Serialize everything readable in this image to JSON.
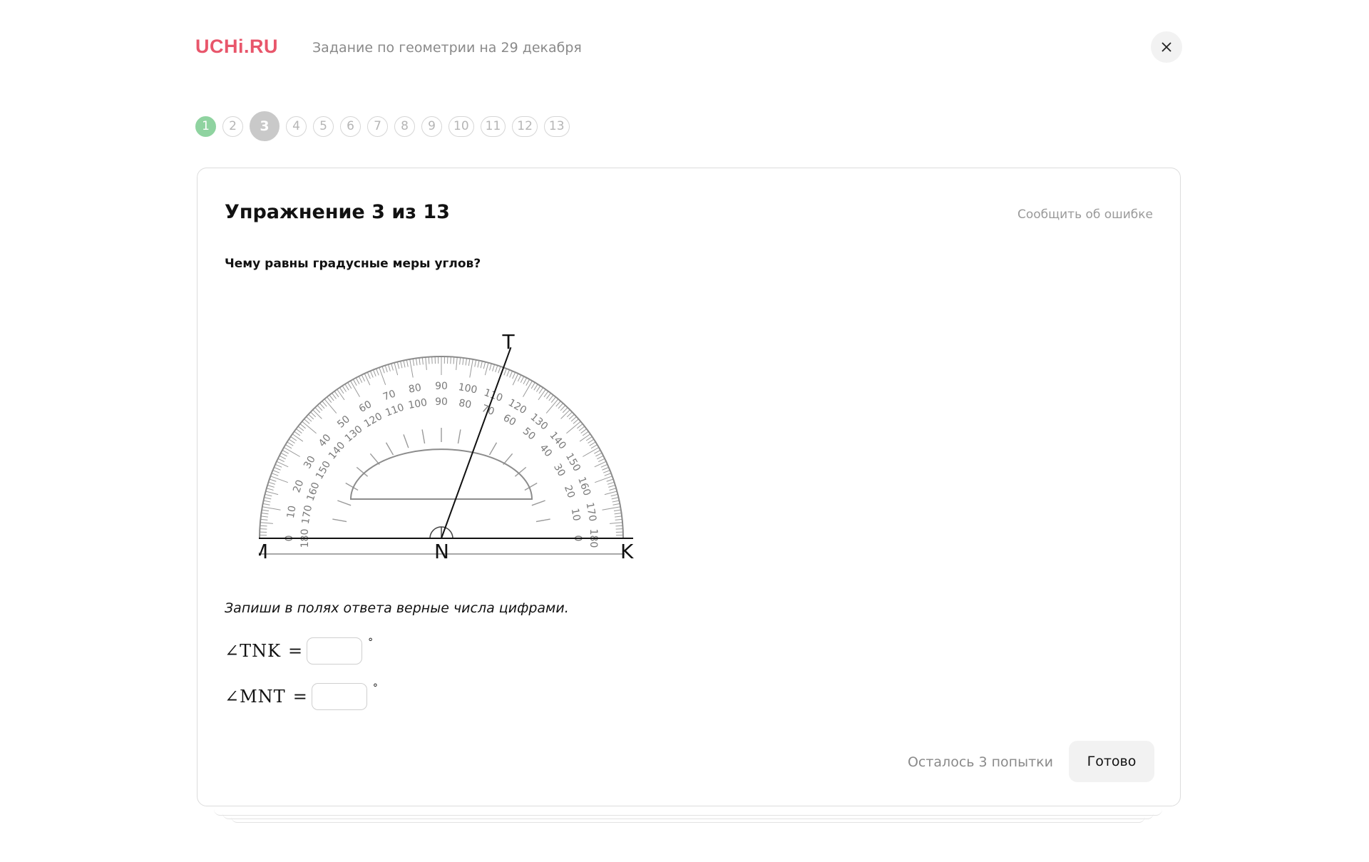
{
  "header": {
    "logo": "UCHi.RU",
    "title": "Задание по геометрии на 29 декабря"
  },
  "steps": [
    "1",
    "2",
    "3",
    "4",
    "5",
    "6",
    "7",
    "8",
    "9",
    "10",
    "11",
    "12",
    "13"
  ],
  "steps_state": {
    "done": [
      1
    ],
    "current": 3
  },
  "exercise": {
    "title": "Упражнение 3 из 13",
    "report_link": "Сообщить об ошибке",
    "question": "Чему равны градусные меры углов?",
    "instruction": "Запиши в полях ответа верные числа цифрами.",
    "answers": [
      {
        "label": "∠TNK",
        "equals": "=",
        "value": "",
        "unit": "°"
      },
      {
        "label": "∠MNT",
        "equals": "=",
        "value": "",
        "unit": "°"
      }
    ],
    "attempts": "Осталось 3 попытки",
    "submit_label": "Готово"
  },
  "figure": {
    "points": {
      "M": "M",
      "N": "N",
      "K": "K",
      "T": "T"
    },
    "outer_scale": [
      "0",
      "10",
      "20",
      "30",
      "40",
      "50",
      "60",
      "70",
      "80",
      "90",
      "100",
      "110",
      "120",
      "130",
      "140",
      "150",
      "160",
      "170",
      "180"
    ],
    "inner_scale": [
      "180",
      "170",
      "160",
      "150",
      "140",
      "130",
      "120",
      "110",
      "100",
      "90",
      "80",
      "70",
      "60",
      "50",
      "40",
      "30",
      "20",
      "10",
      "0"
    ],
    "ray_T_angle": 70
  },
  "icons": {
    "close": "close-icon"
  },
  "colors": {
    "logo": "#e8566b",
    "step_done": "#8fd3a0",
    "step_current": "#c9c9c9"
  }
}
